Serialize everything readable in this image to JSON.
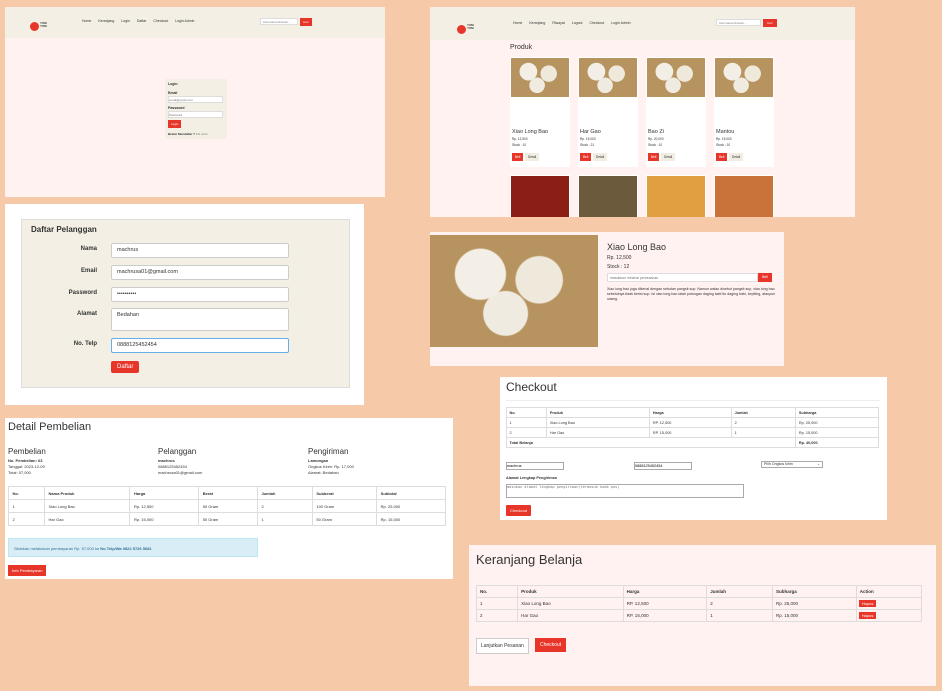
{
  "login_page": {
    "nav": [
      "Home",
      "Keranjang",
      "Login",
      "Daftar",
      "Checkout",
      "Login Admin"
    ],
    "logo_text": "YUM YUM",
    "search_placeholder": "Cari nama dimsum...",
    "search_button": "Cari",
    "title": "Login",
    "email_label": "Email",
    "email_placeholder": "email@gmail.com",
    "password_label": "Password",
    "password_placeholder": "Password",
    "login_button": "Login",
    "register_prompt": "Belum Mendaftar ?",
    "register_link": "klik disini"
  },
  "products_page": {
    "nav": [
      "Home",
      "Keranjang",
      "Riwayat",
      "Logout",
      "Checkout",
      "Login Admin"
    ],
    "logo_text": "YUM YUM",
    "search_placeholder": "Cari nama dimsum...",
    "search_button": "Cari",
    "title": "Produk",
    "buy_label": "Beli",
    "detail_label": "Detail",
    "products": [
      {
        "name": "Xiao Long Bao",
        "price": "Rp. 12,500",
        "stock": "Stock : 10"
      },
      {
        "name": "Har Gao",
        "price": "Rp. 15,000",
        "stock": "Stock : 21"
      },
      {
        "name": "Bao Zi",
        "price": "Rp. 20,000",
        "stock": "Stock : 10"
      },
      {
        "name": "Mantou",
        "price": "Rp. 15,000",
        "stock": "Stock : 10"
      }
    ]
  },
  "register": {
    "title": "Daftar Pelanggan",
    "fields": [
      {
        "label": "Nama",
        "value": "machrus"
      },
      {
        "label": "Email",
        "value": "machrusa01@gmail.com"
      },
      {
        "label": "Password",
        "value": "••••••••••"
      },
      {
        "label": "Alamat",
        "value": "Bedahan"
      },
      {
        "label": "No. Telp",
        "value": "0888125452454"
      }
    ],
    "submit": "Daftar"
  },
  "product_detail": {
    "name": "Xiao Long Bao",
    "price": "Rp. 12,500",
    "stock": "Stock : 12",
    "qty_placeholder": "masukkan minimal pemesanan",
    "buy_button": "Beli",
    "description": "Xiao long bao juga dikenal dengan sebutan pangsit sup. Namun walau disebut pangsit sup, xiao long bao sebetulnya tidak berisi sup. Isi xiao long bao ialah potongan daging babi itu daging babi, kepiting, ataupun udang."
  },
  "checkout": {
    "title": "Checkout",
    "headers": [
      "No.",
      "Produk",
      "Harga",
      "Jumlah",
      "Subharga"
    ],
    "rows": [
      [
        "1",
        "Xiao Long Bao",
        "RP. 12,500",
        "2",
        "Rp. 25,000"
      ],
      [
        "2",
        "Har Gao",
        "RP. 15,000",
        "1",
        "Rp. 15,000"
      ]
    ],
    "total_label": "Total Belanja",
    "total": "Rp. 40,000",
    "name_value": "machrus",
    "phone_value": "0888125452454",
    "shipping_select": "Pilih Ongkos kirim",
    "address_label": "Alamat Lengkap Pengiriman",
    "address_placeholder": "masukan alamat lengkap pengiriman(termasuk kode pos)",
    "button": "Checkout"
  },
  "purchase_detail": {
    "title": "Detail Pembelian",
    "pembelian": {
      "heading": "Pembelian",
      "no": "No. Pembelian: 63",
      "date": "Tanggal: 2023-12-09",
      "total": "Total: 57,000"
    },
    "pelanggan": {
      "heading": "Pelanggan",
      "name": "machrus",
      "phone": "0888125452454",
      "email": "machrusa01@gmail.com"
    },
    "pengiriman": {
      "heading": "Pengiriman",
      "city": "Lamongan",
      "cost": "Ongkos Kirim: Rp. 17,000",
      "address": "Alamat: Bedahan"
    },
    "headers": [
      "No.",
      "Nama Produk",
      "Harga",
      "Berat",
      "Jumlah",
      "Subberat",
      "Subtotal"
    ],
    "rows": [
      [
        "1",
        "Xiao Long Bao",
        "Rp. 12,500",
        "50 Gram",
        "2",
        "100 Gram",
        "Rp. 25,000"
      ],
      [
        "2",
        "Har Gao",
        "Rp. 15,000",
        "50 Gram",
        "1",
        "50 Gram",
        "Rp. 15,000"
      ]
    ],
    "alert_text": "Silahkan melakukan pembayaran Rp. 57,000 ke ",
    "alert_bold": "No.Telp/Wa 0822 5726 5681",
    "button": "Info Pembayaran"
  },
  "cart": {
    "title": "Keranjang Belanja",
    "headers": [
      "No.",
      "Produk",
      "Harga",
      "Jumlah",
      "Subharga",
      "Action"
    ],
    "rows": [
      [
        "1",
        "Xiao Long Bao",
        "RP. 12,500",
        "2",
        "Rp. 25,000"
      ],
      [
        "2",
        "Har Gao",
        "RP. 15,000",
        "1",
        "Rp. 15,000"
      ]
    ],
    "delete_label": "Hapus",
    "continue_button": "Lanjutkan Pesanan",
    "checkout_button": "Checkout"
  },
  "colors": {
    "background": "#f6c9a9",
    "accent": "#e8352a",
    "nav": "#f3efe4",
    "page": "#fff2f0"
  }
}
